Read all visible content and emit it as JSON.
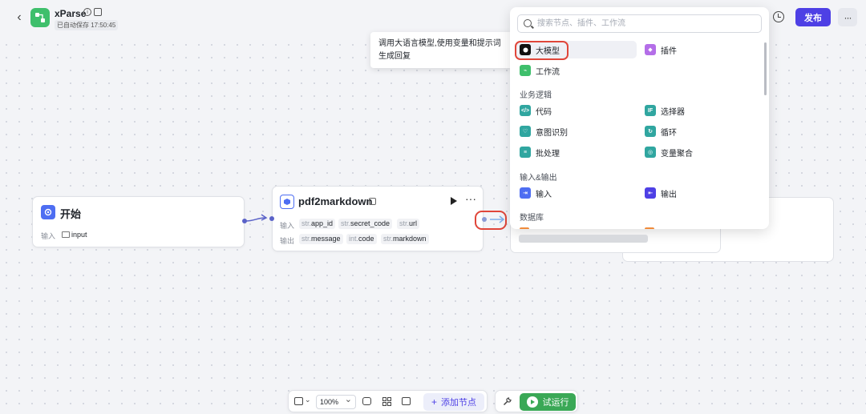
{
  "header": {
    "app_name": "xParse",
    "save_status": "已自动保存 17:50:45",
    "publish_label": "发布",
    "more_label": "···"
  },
  "tooltip": {
    "text": "调用大语言模型,使用变量和提示词生成回复"
  },
  "start_node": {
    "title": "开始",
    "input_label": "输入",
    "input_param": "input"
  },
  "pdf_node": {
    "title": "pdf2markdown",
    "input_label": "输入",
    "output_label": "输出",
    "inputs": [
      {
        "type": "str.",
        "name": "app_id"
      },
      {
        "type": "str.",
        "name": "secret_code"
      },
      {
        "type": "str.",
        "name": "url"
      }
    ],
    "outputs": [
      {
        "type": "str.",
        "name": "message"
      },
      {
        "type": "int.",
        "name": "code"
      },
      {
        "type": "str.",
        "name": "markdown"
      }
    ],
    "more_label": "···"
  },
  "picker": {
    "search_placeholder": "搜索节点、插件、工作流",
    "top_items": [
      {
        "label": "大模型",
        "icon": "llm-icon"
      },
      {
        "label": "插件",
        "icon": "plugin-icon"
      },
      {
        "label": "工作流",
        "icon": "workflow-icon"
      }
    ],
    "sections": [
      {
        "title": "业务逻辑",
        "items": [
          {
            "label": "代码",
            "icon": "code-icon"
          },
          {
            "label": "选择器",
            "icon": "if-icon"
          },
          {
            "label": "意图识别",
            "icon": "intent-icon"
          },
          {
            "label": "循环",
            "icon": "loop-icon"
          },
          {
            "label": "批处理",
            "icon": "batch-icon"
          },
          {
            "label": "变量聚合",
            "icon": "aggregate-icon"
          }
        ]
      },
      {
        "title": "输入&输出",
        "items": [
          {
            "label": "输入",
            "icon": "input-icon"
          },
          {
            "label": "输出",
            "icon": "output-icon"
          }
        ]
      },
      {
        "title": "数据库",
        "items": []
      }
    ]
  },
  "toolbar": {
    "zoom": "100%",
    "add_node_label": "添加节点",
    "add_node_plus": "+",
    "trial_run_label": "试运行"
  },
  "colors": {
    "accent": "#4e40e5",
    "run_green": "#3aa856",
    "highlight_red": "#e0463a"
  }
}
